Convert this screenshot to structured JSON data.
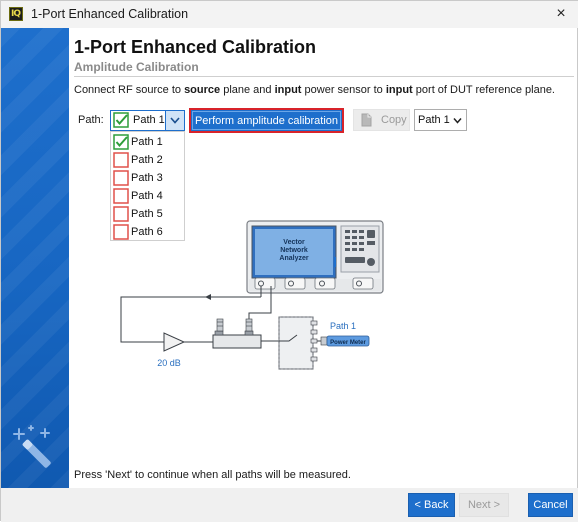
{
  "window": {
    "title": "1-Port Enhanced Calibration",
    "app_icon": "IQ",
    "close_icon": "×"
  },
  "header": {
    "title": "1-Port Enhanced Calibration",
    "subtitle": "Amplitude Calibration"
  },
  "instruction": {
    "part1": "Connect RF source to ",
    "bold1": "source",
    "part2": " plane and ",
    "bold2": "input",
    "part3": " power sensor to ",
    "bold3": "input",
    "part4": " port of DUT reference plane."
  },
  "path_selector": {
    "label": "Path:",
    "selected": "Path 1",
    "options": [
      {
        "label": "Path 1",
        "checked": true
      },
      {
        "label": "Path 2",
        "checked": false
      },
      {
        "label": "Path 3",
        "checked": false
      },
      {
        "label": "Path 4",
        "checked": false
      },
      {
        "label": "Path 5",
        "checked": false
      },
      {
        "label": "Path 6",
        "checked": false
      }
    ]
  },
  "toolbar": {
    "perform_label": "Perform amplitude calibration",
    "copy_label": "Copy",
    "copy_target": "Path 1"
  },
  "diagram": {
    "vna_line1": "Vector",
    "vna_line2": "Network",
    "vna_line3": "Analyzer",
    "amplifier_gain": "20 dB",
    "path_label": "Path 1",
    "power_meter_label": "Power Meter"
  },
  "status": {
    "text": "Press 'Next' to continue when all paths will be measured."
  },
  "footer": {
    "back_label": "< Back",
    "next_label": "Next >",
    "cancel_label": "Cancel"
  },
  "colors": {
    "accent": "#1e6fcc",
    "check_green": "#2e9e3a",
    "unchecked_red": "#e0504a",
    "highlight_border": "#d8232a"
  },
  "icons": {
    "app": "iq-app-icon",
    "close": "close-icon",
    "wizard": "magic-wand-icon",
    "copy": "copy-icon",
    "dropdown": "chevron-down-icon"
  }
}
